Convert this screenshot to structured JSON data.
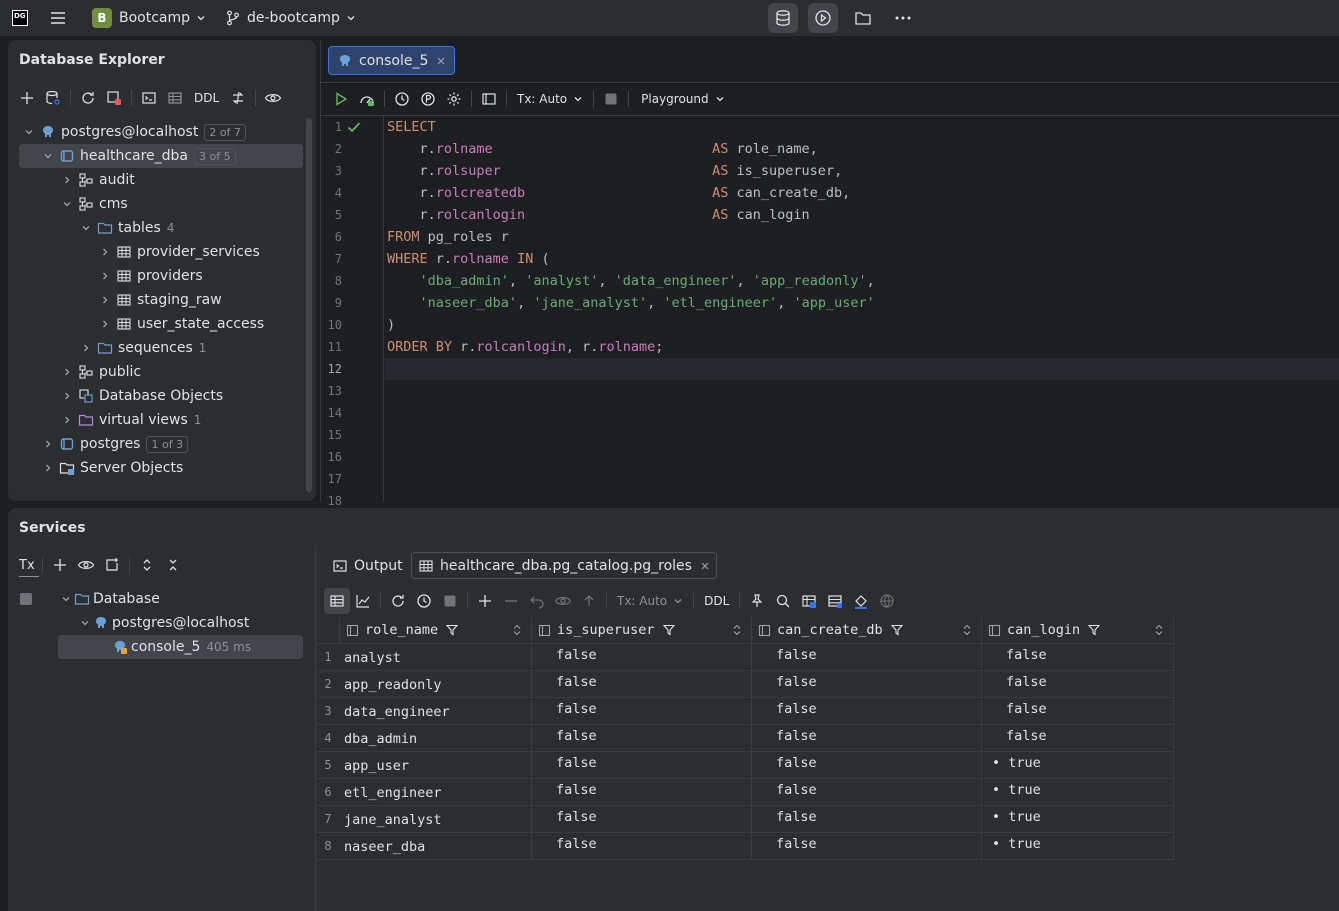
{
  "topbar": {
    "app_logo": "DG",
    "project_badge": "B",
    "project": "Bootcamp",
    "branch": "de-bootcamp"
  },
  "db_explorer": {
    "title": "Database Explorer",
    "toolbar_ddl": "DDL",
    "tree": [
      {
        "label": "postgres@localhost",
        "badge": "2 of 7",
        "icon": "postgres-elephant-icon",
        "level": 0,
        "expanded": true
      },
      {
        "label": "healthcare_dba",
        "badge": "3 of 5",
        "icon": "database-icon",
        "level": 1,
        "expanded": true,
        "selected": true
      },
      {
        "label": "audit",
        "icon": "schema-icon",
        "level": 2,
        "expanded": false
      },
      {
        "label": "cms",
        "icon": "schema-icon",
        "level": 2,
        "expanded": true
      },
      {
        "label": "tables",
        "count": "4",
        "icon": "folder-icon",
        "level": 3,
        "expanded": true
      },
      {
        "label": "provider_services",
        "icon": "table-icon",
        "level": 4,
        "expanded": false
      },
      {
        "label": "providers",
        "icon": "table-icon",
        "level": 4,
        "expanded": false
      },
      {
        "label": "staging_raw",
        "icon": "table-icon",
        "level": 4,
        "expanded": false
      },
      {
        "label": "user_state_access",
        "icon": "table-icon",
        "level": 4,
        "expanded": false
      },
      {
        "label": "sequences",
        "count": "1",
        "icon": "folder-icon",
        "level": 3,
        "expanded": false
      },
      {
        "label": "public",
        "icon": "schema-icon",
        "level": 2,
        "expanded": false
      },
      {
        "label": "Database Objects",
        "icon": "db-objects-icon",
        "level": 2,
        "expanded": false
      },
      {
        "label": "virtual views",
        "count": "1",
        "icon": "virtual-folder-icon",
        "level": 2,
        "expanded": false
      },
      {
        "label": "postgres",
        "badge": "1 of 3",
        "icon": "database-icon",
        "level": 1,
        "expanded": false
      },
      {
        "label": "Server Objects",
        "icon": "server-objects-icon",
        "level": 1,
        "expanded": false
      }
    ]
  },
  "editor": {
    "tab_label": "console_5",
    "tx_label": "Tx: Auto",
    "playground_label": "Playground",
    "line_numbers": [
      "1",
      "2",
      "3",
      "4",
      "5",
      "6",
      "7",
      "8",
      "9",
      "10",
      "11",
      "12",
      "13",
      "14",
      "15",
      "16",
      "17",
      "18"
    ],
    "code": [
      [
        {
          "t": "kw",
          "v": "SELECT"
        }
      ],
      [
        {
          "t": "",
          "v": "    r."
        },
        {
          "t": "fld",
          "v": "rolname"
        },
        {
          "t": "",
          "v": "                           "
        },
        {
          "t": "kw",
          "v": "AS"
        },
        {
          "t": "",
          "v": " role_name,"
        }
      ],
      [
        {
          "t": "",
          "v": "    r."
        },
        {
          "t": "fld",
          "v": "rolsuper"
        },
        {
          "t": "",
          "v": "                          "
        },
        {
          "t": "kw",
          "v": "AS"
        },
        {
          "t": "",
          "v": " is_superuser,"
        }
      ],
      [
        {
          "t": "",
          "v": "    r."
        },
        {
          "t": "fld",
          "v": "rolcreatedb"
        },
        {
          "t": "",
          "v": "                       "
        },
        {
          "t": "kw",
          "v": "AS"
        },
        {
          "t": "",
          "v": " can_create_db,"
        }
      ],
      [
        {
          "t": "",
          "v": "    r."
        },
        {
          "t": "fld",
          "v": "rolcanlogin"
        },
        {
          "t": "",
          "v": "                       "
        },
        {
          "t": "kw",
          "v": "AS"
        },
        {
          "t": "",
          "v": " can_login"
        }
      ],
      [
        {
          "t": "kw",
          "v": "FROM"
        },
        {
          "t": "",
          "v": " pg_roles r"
        }
      ],
      [
        {
          "t": "kw",
          "v": "WHERE"
        },
        {
          "t": "",
          "v": " r."
        },
        {
          "t": "fld",
          "v": "rolname"
        },
        {
          "t": "",
          "v": " "
        },
        {
          "t": "kw",
          "v": "IN"
        },
        {
          "t": "",
          "v": " ("
        }
      ],
      [
        {
          "t": "",
          "v": "    "
        },
        {
          "t": "str",
          "v": "'dba_admin'"
        },
        {
          "t": "",
          "v": ", "
        },
        {
          "t": "str",
          "v": "'analyst'"
        },
        {
          "t": "",
          "v": ", "
        },
        {
          "t": "str",
          "v": "'data_engineer'"
        },
        {
          "t": "",
          "v": ", "
        },
        {
          "t": "str",
          "v": "'app_readonly'"
        },
        {
          "t": "",
          "v": ","
        }
      ],
      [
        {
          "t": "",
          "v": "    "
        },
        {
          "t": "str",
          "v": "'naseer_dba'"
        },
        {
          "t": "",
          "v": ", "
        },
        {
          "t": "str",
          "v": "'jane_analyst'"
        },
        {
          "t": "",
          "v": ", "
        },
        {
          "t": "str",
          "v": "'etl_engineer'"
        },
        {
          "t": "",
          "v": ", "
        },
        {
          "t": "str",
          "v": "'app_user'"
        }
      ],
      [
        {
          "t": "",
          "v": ")"
        }
      ],
      [
        {
          "t": "kw",
          "v": "ORDER BY"
        },
        {
          "t": "",
          "v": " r."
        },
        {
          "t": "fld",
          "v": "rolcanlogin"
        },
        {
          "t": "",
          "v": ", r."
        },
        {
          "t": "fld",
          "v": "rolname"
        },
        {
          "t": "",
          "v": ";"
        }
      ]
    ]
  },
  "services": {
    "title": "Services",
    "tx_label": "Tx",
    "tree": [
      {
        "label": "Database",
        "icon": "folder-icon",
        "level": 0
      },
      {
        "label": "postgres@localhost",
        "icon": "postgres-elephant-icon",
        "level": 1
      },
      {
        "label": "console_5",
        "meta": "405 ms",
        "icon": "console-icon",
        "level": 2,
        "selected": true
      }
    ],
    "tabs": [
      {
        "label": "Output",
        "icon": "output-icon"
      },
      {
        "label": "healthcare_dba.pg_catalog.pg_roles",
        "icon": "table-icon",
        "active": true
      }
    ],
    "grid_tx_label": "Tx: Auto",
    "grid_ddl_label": "DDL"
  },
  "result": {
    "columns": [
      "role_name",
      "is_superuser",
      "can_create_db",
      "can_login"
    ],
    "rows": [
      [
        "analyst",
        "false",
        "false",
        "false"
      ],
      [
        "app_readonly",
        "false",
        "false",
        "false"
      ],
      [
        "data_engineer",
        "false",
        "false",
        "false"
      ],
      [
        "dba_admin",
        "false",
        "false",
        "false"
      ],
      [
        "app_user",
        "false",
        "false",
        "• true"
      ],
      [
        "etl_engineer",
        "false",
        "false",
        "• true"
      ],
      [
        "jane_analyst",
        "false",
        "false",
        "• true"
      ],
      [
        "naseer_dba",
        "false",
        "false",
        "• true"
      ]
    ]
  },
  "colors": {
    "accent": "#3574f0",
    "keyword": "#cf8e6d",
    "field": "#c77dbb",
    "string": "#6aab73",
    "run_green": "#5fb865"
  }
}
